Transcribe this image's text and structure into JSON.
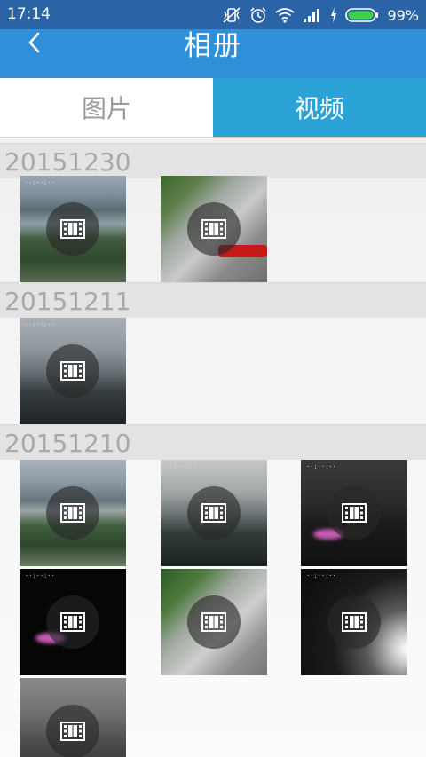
{
  "status_bar": {
    "time": "17:14",
    "battery_percent": "99%"
  },
  "app_bar": {
    "title": "相册",
    "back_icon": "chevron-left-icon"
  },
  "tabs": [
    {
      "label": "图片",
      "selected": false
    },
    {
      "label": "视频",
      "selected": true
    }
  ],
  "groups": [
    {
      "date": "20151230"
    },
    {
      "date": "20151211"
    },
    {
      "date": "20151210"
    }
  ],
  "colors": {
    "status_bar": "#2a63a6",
    "app_bar": "#2f8fd8",
    "tab_selected": "#2ca3d6",
    "tab_unselected": "#ffffff",
    "group_header": "#e3e3e3"
  }
}
